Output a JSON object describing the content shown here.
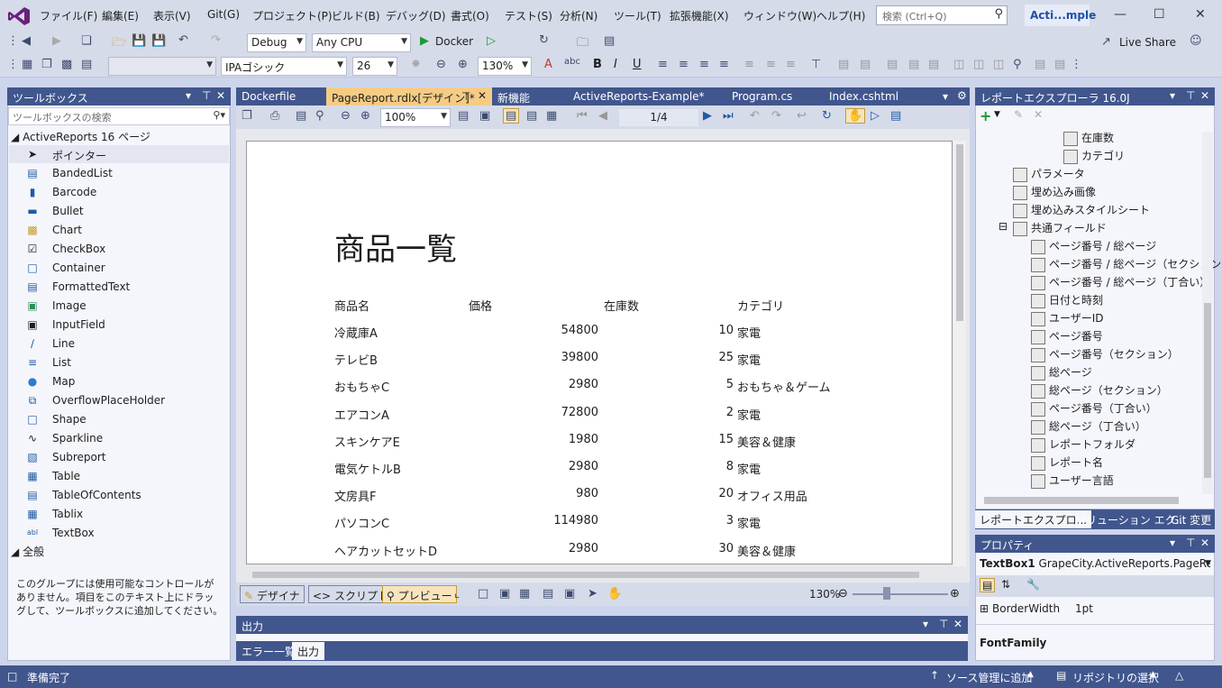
{
  "menu": {
    "items": [
      "ファイル(F)",
      "編集(E)",
      "表示(V)",
      "Git(G)",
      "プロジェクト(P)",
      "ビルド(B)",
      "デバッグ(D)",
      "書式(O)",
      "テスト(S)",
      "分析(N)",
      "ツール(T)",
      "拡張機能(X)",
      "ウィンドウ(W)",
      "ヘルプ(H)"
    ],
    "search_placeholder": "検索 (Ctrl+Q)",
    "solution_badge": "Acti...mple"
  },
  "toolbar": {
    "config": "Debug",
    "platform": "Any CPU",
    "run_target": "Docker",
    "live_share": "Live Share",
    "font_name": "IPAゴシック",
    "font_size": "26",
    "zoom": "130%",
    "bold": "B",
    "italic": "I",
    "underline": "U"
  },
  "toolbox": {
    "title": "ツールボックス",
    "search_placeholder": "ツールボックスの検索",
    "group1": "ActiveReports 16 ページ",
    "items": [
      "ポインター",
      "BandedList",
      "Barcode",
      "Bullet",
      "Chart",
      "CheckBox",
      "Container",
      "FormattedText",
      "Image",
      "InputField",
      "Line",
      "List",
      "Map",
      "OverflowPlaceHolder",
      "Shape",
      "Sparkline",
      "Subreport",
      "Table",
      "TableOfContents",
      "Tablix",
      "TextBox"
    ],
    "group2": "全般",
    "note": "このグループには使用可能なコントロールがありません。項目をこのテキスト上にドラッグして、ツールボックスに追加してください。"
  },
  "tabs": [
    "Dockerfile",
    "PageReport.rdlx[デザイン]*",
    "新機能",
    "ActiveReports-Example*",
    "Program.cs",
    "Index.cshtml"
  ],
  "viewer": {
    "zoom": "100%",
    "page": "1/4",
    "bottom_zoom": "130%"
  },
  "report": {
    "title": "商品一覧",
    "headers": [
      "商品名",
      "価格",
      "在庫数",
      "カテゴリ"
    ],
    "rows": [
      {
        "name": "冷蔵庫A",
        "price": "54800",
        "stock": "10",
        "cat": "家電"
      },
      {
        "name": "テレビB",
        "price": "39800",
        "stock": "25",
        "cat": "家電"
      },
      {
        "name": "おもちゃC",
        "price": "2980",
        "stock": "5",
        "cat": "おもちゃ＆ゲーム"
      },
      {
        "name": "エアコンA",
        "price": "72800",
        "stock": "2",
        "cat": "家電"
      },
      {
        "name": "スキンケアE",
        "price": "1980",
        "stock": "15",
        "cat": "美容＆健康"
      },
      {
        "name": "電気ケトルB",
        "price": "2980",
        "stock": "8",
        "cat": "家電"
      },
      {
        "name": "文房具F",
        "price": "980",
        "stock": "20",
        "cat": "オフィス用品"
      },
      {
        "name": "パソコンC",
        "price": "114980",
        "stock": "3",
        "cat": "家電"
      },
      {
        "name": "ヘアカットセットD",
        "price": "2980",
        "stock": "30",
        "cat": "美容＆健康"
      }
    ]
  },
  "bottombar": {
    "designer": "デザイナ",
    "script": "スクリプト",
    "preview": "プレビュー"
  },
  "output": {
    "title": "出力",
    "tabs": [
      "エラー一覧",
      "出力"
    ]
  },
  "report_explorer": {
    "title": "レポートエクスプローラ 16.0J",
    "tree": [
      "在庫数",
      "カテゴリ",
      "パラメータ",
      "埋め込み画像",
      "埋め込みスタイルシート",
      "共通フィールド",
      "ページ番号 / 総ページ",
      "ページ番号 / 総ページ（セクション）",
      "ページ番号 / 総ページ（丁合い）",
      "日付と時刻",
      "ユーザーID",
      "ページ番号",
      "ページ番号（セクション）",
      "総ページ",
      "総ページ（セクション）",
      "ページ番号（丁合い）",
      "総ページ（丁合い）",
      "レポートフォルダ",
      "レポート名",
      "ユーザー言語"
    ],
    "tabs": [
      "レポートエクスプロ...",
      "ソリューション エク...",
      "Git 変更"
    ]
  },
  "properties": {
    "title": "プロパティ",
    "object": "TextBox1",
    "object_type": "GrapeCity.ActiveReports.PageReport",
    "prop_name": "BorderWidth",
    "prop_value": "1pt",
    "desc": "FontFamily"
  },
  "status": {
    "ready": "準備完了",
    "source_control": "ソース管理に追加",
    "repo": "リポジトリの選択"
  }
}
